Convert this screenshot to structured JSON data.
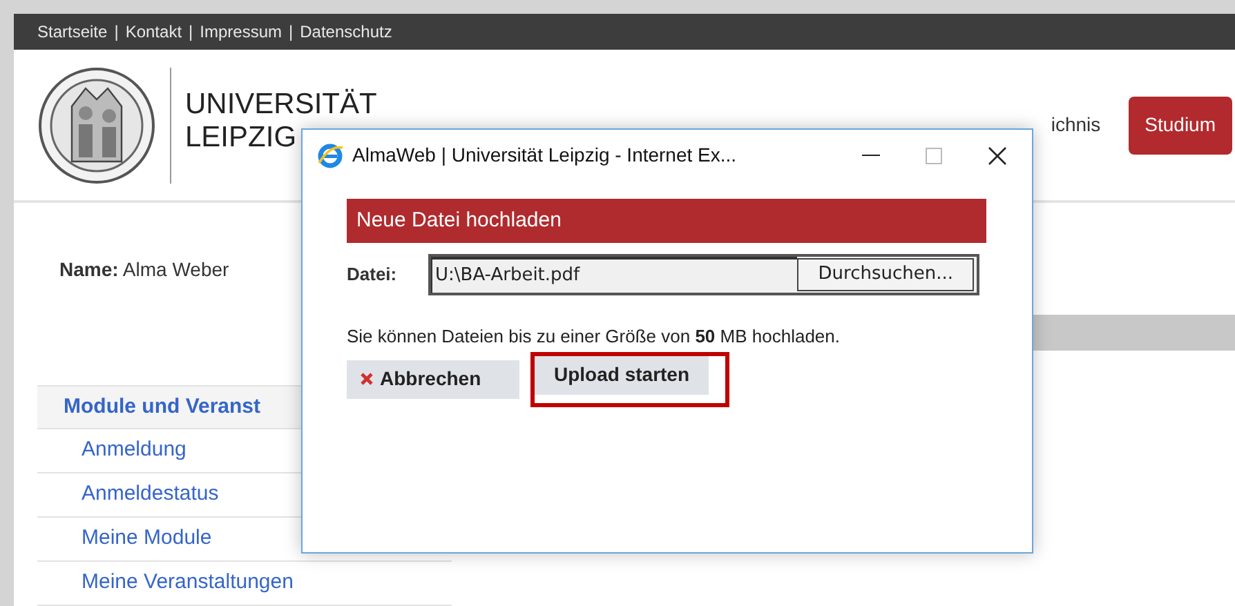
{
  "top_links": [
    "Startseite",
    "Kontakt",
    "Impressum",
    "Datenschutz"
  ],
  "top_separator": "|",
  "logo": {
    "line1": "UNIVERSITÄT",
    "line2": "LEIPZIG"
  },
  "nav": {
    "fragment": "ichnis",
    "button": "Studium"
  },
  "user": {
    "label": "Name:",
    "value": "Alma Weber"
  },
  "sidebar": {
    "heading": "Module und Veranst",
    "items": [
      "Anmeldung",
      "Anmeldestatus",
      "Meine Module",
      "Meine Veranstaltungen"
    ]
  },
  "popup": {
    "title": "AlmaWeb | Universität Leipzig - Internet Ex...",
    "header": "Neue Datei hochladen",
    "file_label": "Datei:",
    "file_value": "U:\\BA-Arbeit.pdf",
    "browse": "Durchsuchen...",
    "note": "Sie können Dateien bis zu einer Größe von **50** MB hochladen.",
    "cancel": "Abbrechen",
    "upload": "Upload starten",
    "upload_highlighted": true
  }
}
